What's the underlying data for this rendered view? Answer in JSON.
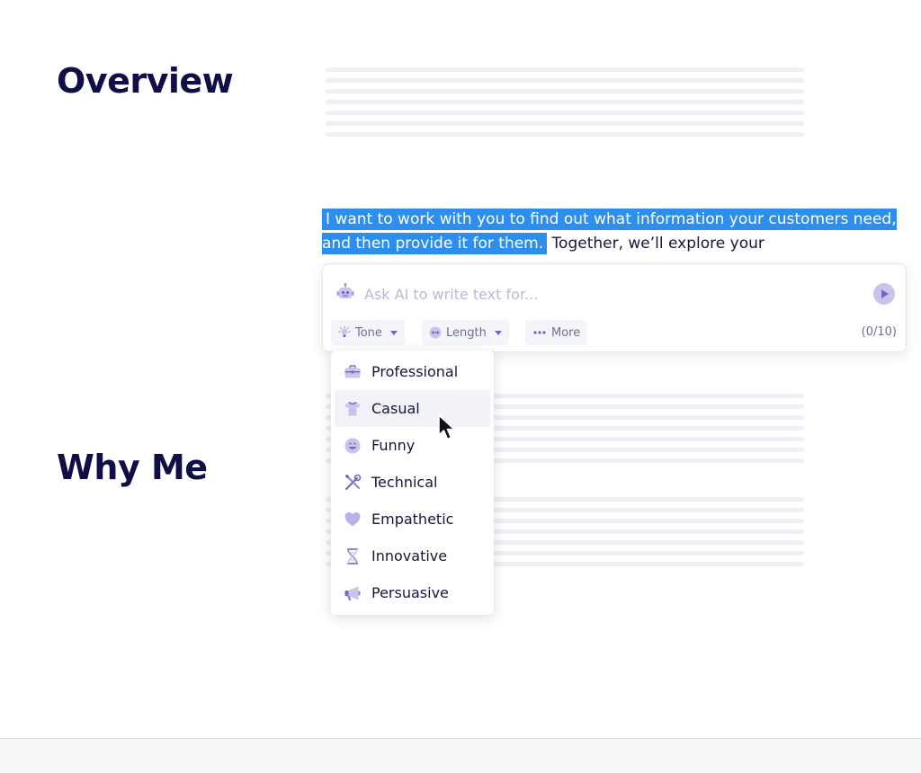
{
  "sections": {
    "overview_title": "Overview",
    "whyme_title": "Why Me"
  },
  "paragraph": {
    "selected_text": "I want to work with you to find out what information your customers need, and then provide it for them.",
    "rest_text": " Together, we’ll explore your"
  },
  "ai_panel": {
    "placeholder": "Ask AI to write text for...",
    "tone_label": "Tone",
    "length_label": "Length",
    "more_label": "More",
    "counter": "(0/10)"
  },
  "tone_menu": {
    "hovered": "Casual",
    "items": [
      {
        "label": "Professional",
        "icon": "briefcase-icon"
      },
      {
        "label": "Casual",
        "icon": "tshirt-icon"
      },
      {
        "label": "Funny",
        "icon": "smiley-icon"
      },
      {
        "label": "Technical",
        "icon": "tools-icon"
      },
      {
        "label": "Empathetic",
        "icon": "heart-icon"
      },
      {
        "label": "Innovative",
        "icon": "dna-icon"
      },
      {
        "label": "Persuasive",
        "icon": "megaphone-icon"
      }
    ]
  },
  "colors": {
    "selection": "#2c8ff0",
    "heading": "#0f0f48",
    "icon_accent": "#7466c8",
    "icon_light": "#c9c4ec"
  }
}
